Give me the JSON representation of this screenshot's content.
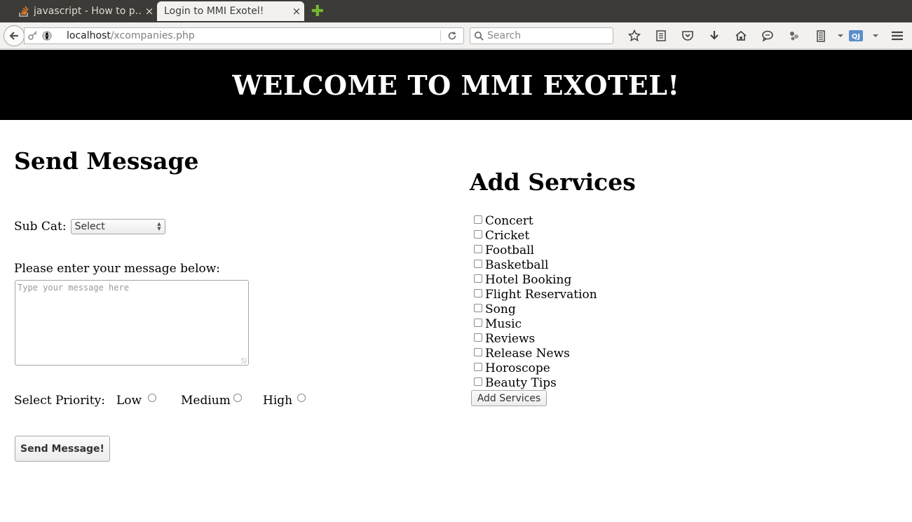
{
  "browser": {
    "tabs": [
      {
        "title": "javascript - How to p…",
        "close": "×",
        "active": false
      },
      {
        "title": "Login to MMI Exotel!",
        "close": "×",
        "active": true
      }
    ],
    "new_tab": "✚",
    "url_host": "localhost",
    "url_path": "/xcompanies.php",
    "search_placeholder": "Search"
  },
  "page": {
    "banner_title": "WELCOME TO MMI EXOTEL!",
    "send_message": {
      "heading": "Send Message",
      "subcat_label": "Sub Cat:",
      "subcat_selected": "Select",
      "message_label": "Please enter your message below:",
      "message_placeholder": "Type your message here",
      "priority_label": "Select Priority:",
      "priority_options": [
        "Low",
        "Medium",
        "High"
      ],
      "submit_label": "Send Message!"
    },
    "add_services": {
      "heading": "Add Services",
      "services": [
        "Concert",
        "Cricket",
        "Football",
        "Basketball",
        "Hotel Booking",
        "Flight Reservation",
        "Song",
        "Music",
        "Reviews",
        "Release News",
        "Horoscope",
        "Beauty Tips"
      ],
      "submit_label": "Add Services"
    }
  },
  "colors": {
    "banner_bg": "#000000",
    "banner_text": "#ffffff",
    "tabbar_bg": "#3c3b37",
    "toolbar_bg": "#f2f1f0",
    "new_tab_icon": "#74b72e"
  }
}
